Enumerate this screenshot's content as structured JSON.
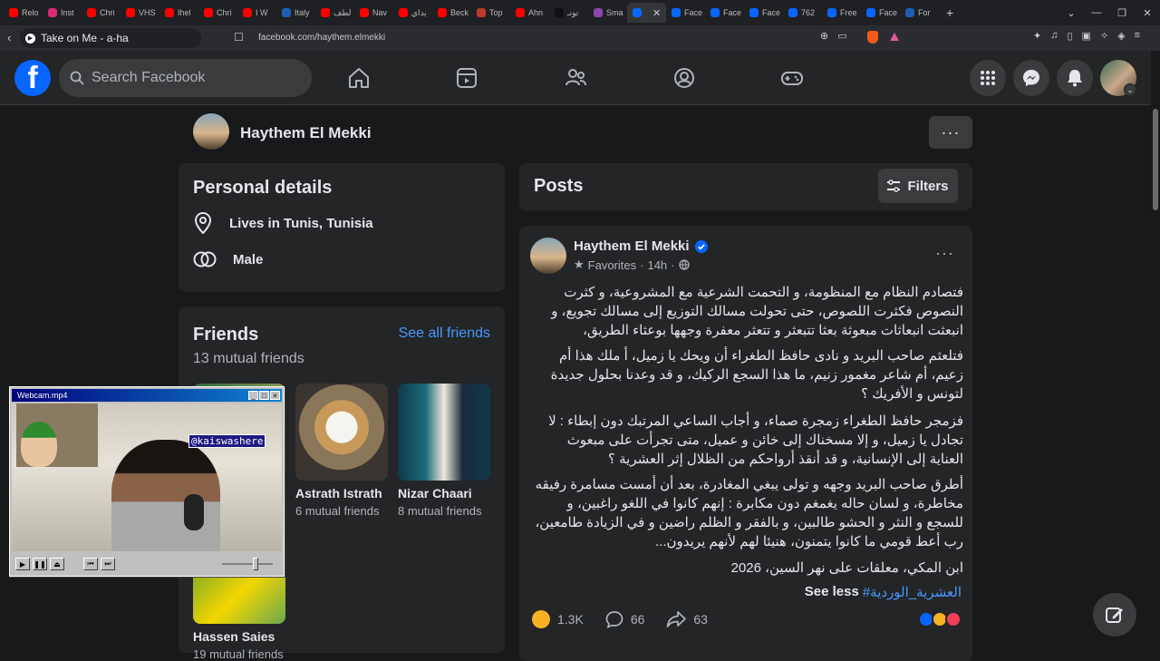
{
  "browser": {
    "tabs": [
      {
        "label": "Relo",
        "color": "#ff0000"
      },
      {
        "label": "Inst",
        "color": "#d62976"
      },
      {
        "label": "Chri",
        "color": "#ff0000"
      },
      {
        "label": "VHS",
        "color": "#ff0000"
      },
      {
        "label": "Ihel",
        "color": "#ff0000"
      },
      {
        "label": "Chri",
        "color": "#ff0000"
      },
      {
        "label": "I W",
        "color": "#ff0000"
      },
      {
        "label": "Italy",
        "color": "#1a5fb4"
      },
      {
        "label": "لطف",
        "color": "#ff0000"
      },
      {
        "label": "Nav",
        "color": "#ff0000"
      },
      {
        "label": "يداي",
        "color": "#ff0000"
      },
      {
        "label": "Beck",
        "color": "#ff0000"
      },
      {
        "label": "Top",
        "color": "#c0392b"
      },
      {
        "label": "Ahn",
        "color": "#ff0000"
      },
      {
        "label": "تونـ",
        "color": "#111111"
      },
      {
        "label": "Sma",
        "color": "#8e44ad"
      },
      {
        "label": "",
        "color": "#0866ff",
        "active": true
      },
      {
        "label": "Face",
        "color": "#0866ff"
      },
      {
        "label": "Face",
        "color": "#0866ff"
      },
      {
        "label": "Face",
        "color": "#0866ff"
      },
      {
        "label": "762",
        "color": "#0866ff"
      },
      {
        "label": "Free",
        "color": "#0866ff"
      },
      {
        "label": "Face",
        "color": "#0866ff"
      },
      {
        "label": "For",
        "color": "#1a5fb4"
      }
    ],
    "new_tab": "+",
    "media_title": "Take on Me - a-ha",
    "url": "facebook.com/haythem.elmekki"
  },
  "fb": {
    "search_placeholder": "Search Facebook",
    "accent": "#0866ff"
  },
  "profile": {
    "name": "Haythem El Mekki",
    "more": "···"
  },
  "personal": {
    "title": "Personal details",
    "lives": "Lives in Tunis, Tunisia",
    "gender": "Male"
  },
  "friends": {
    "title": "Friends",
    "see_all": "See all friends",
    "mutual": "13 mutual friends",
    "list": [
      {
        "name": "Astrath Istrath",
        "mutual": "6 mutual friends"
      },
      {
        "name": "Nizar Chaari",
        "mutual": "8 mutual friends"
      },
      {
        "name": "Hassen Saies",
        "mutual": "19 mutual friends"
      }
    ]
  },
  "posts": {
    "title": "Posts",
    "filters": "Filters"
  },
  "post": {
    "author": "Haythem El Mekki",
    "audience": "Favorites",
    "time": "14h",
    "p1": "فتصادم النظام مع المنظومة، و التحمت الشرعية مع المشروعية، و كثرت النصوص فكثرت اللصوص، حتى تحولت مسالك التوزيع إلى مسالك تجويع، و انبعثت انبعاثات مبعوثة بعثا تتبعثر و تتعثر معفرة وجهها بوعثاء الطريق،",
    "p2": "فتلعثم صاحب البريد و نادى حافظ الطغراء أن ويحك يا زميل، أ ملك هذا أم زعيم، أم شاعر مغمور زنيم، ما هذا السجع الركيك، و قد وعدنا بحلول جديدة لتونس و الأفريك ؟",
    "p3": "فزمجر حافظ الطغراء زمجرة صماء، و أجاب الساعي المرتبك دون إبطاء : لا تجادل يا زميل، و إلا مسخناك إلى خائن و عميل، متى تجرأت على مبعوث العناية إلى الإنسانية، و قد أنقذ أرواحكم من الظلال إثر العشرية ؟",
    "p4": "أطرق صاحب البريد وجهه و تولى يبغي المغادرة، بعد أن أمست مسامرة رفيقه مخاطرة، و لسان حاله يغمغم دون مكابرة : إنهم كانوا في اللغو راغبين، و للسجع و النثر و الحشو طالبين، و بالفقر و الظلم راضين و في الزيادة طامعين، رب أعط قومي ما كانوا يتمنون، هنيئا لهم لأنهم يريدون...",
    "p5": "ابن المكي، معلقات على نهر السين، 2026",
    "see_less": "See less",
    "hashtag": "#العشرية_الوردية",
    "reactions": "1.3K",
    "comments": "66",
    "shares": "63"
  },
  "webcam": {
    "title": "Webcam.mp4",
    "watermark": "@kaiswashere"
  }
}
